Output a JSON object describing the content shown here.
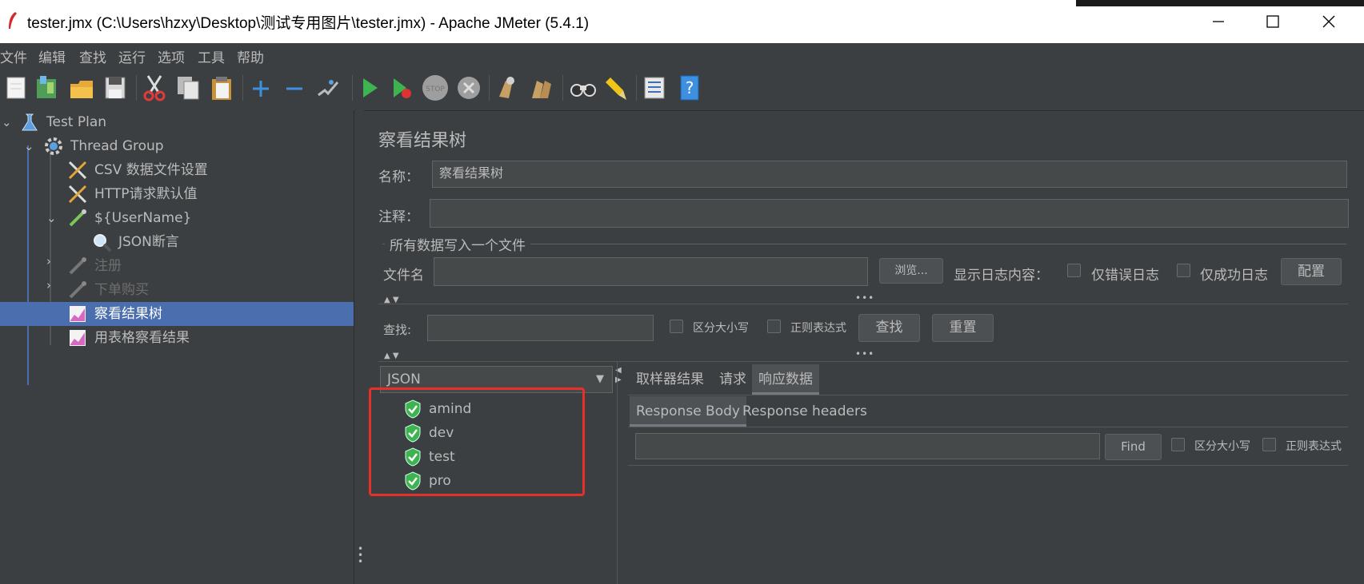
{
  "window": {
    "title": "tester.jmx (C:\\Users\\hzxy\\Desktop\\测试专用图片\\tester.jmx) - Apache JMeter (5.4.1)"
  },
  "menu": [
    "文件",
    "编辑",
    "查找",
    "运行",
    "选项",
    "工具",
    "帮助"
  ],
  "toolbar_icons": [
    "new-icon",
    "templates-icon",
    "open-icon",
    "save-icon",
    "cut-icon",
    "copy-icon",
    "paste-icon",
    "expand-icon",
    "collapse-icon",
    "toggle-icon",
    "start-icon",
    "start-no-pauses-icon",
    "stop-icon",
    "shutdown-icon",
    "clear-icon",
    "clear-all-icon",
    "search-icon",
    "reset-search-icon",
    "function-helper-icon",
    "help-icon"
  ],
  "tree": {
    "test_plan": "Test Plan",
    "thread_group": "Thread Group",
    "csv": "CSV 数据文件设置",
    "http_defaults": "HTTP请求默认值",
    "username": "${UserName}",
    "json_assert": "JSON断言",
    "register": "注册",
    "order": "下单购买",
    "results_tree": "察看结果树",
    "table_results": "用表格察看结果"
  },
  "panel": {
    "title": "察看结果树",
    "name_label": "名称：",
    "name_value": "察看结果树",
    "comment_label": "注释：",
    "comment_value": "",
    "file_section": "所有数据写入一个文件",
    "filename_label": "文件名",
    "filename_value": "",
    "browse": "浏览...",
    "log_label": "显示日志内容：",
    "errors_only": "仅错误日志",
    "success_only": "仅成功日志",
    "configure": "配置",
    "search_label": "查找:",
    "search_value": "",
    "case_sensitive": "区分大小写",
    "regex": "正则表达式",
    "search_btn": "查找",
    "reset_btn": "重置",
    "renderer": "JSON",
    "results": [
      "amind",
      "dev",
      "test",
      "pro"
    ],
    "tabs": [
      "取样器结果",
      "请求",
      "响应数据"
    ],
    "active_tab": "响应数据",
    "subtabs": [
      "Response Body",
      "Response headers"
    ],
    "find_value": "",
    "find_btn": "Find",
    "find_case": "区分大小写",
    "find_regex": "正则表达式"
  },
  "colors": {
    "bg": "#3c3f41",
    "selection": "#4b6eaf",
    "highlight_box": "#e6312a",
    "success": "#3fb34f"
  }
}
